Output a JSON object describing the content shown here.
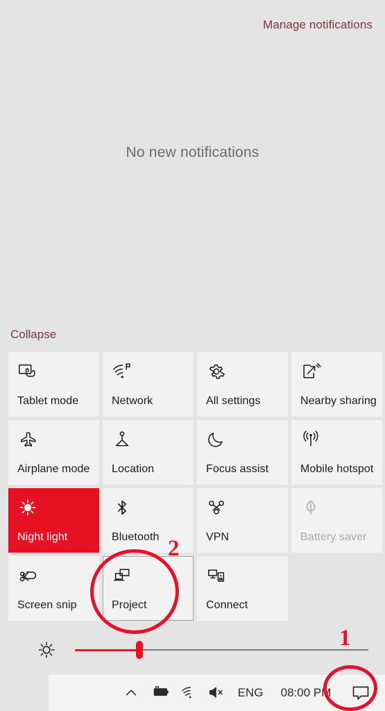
{
  "header": {
    "manage_notifications_label": "Manage notifications"
  },
  "notifications": {
    "empty_text": "No new notifications"
  },
  "collapse": {
    "label": "Collapse"
  },
  "quick_actions": {
    "tiles": [
      {
        "label": "Tablet mode",
        "icon": "tablet-mode-icon",
        "state": "normal"
      },
      {
        "label": "Network",
        "icon": "network-wifi-icon",
        "state": "normal"
      },
      {
        "label": "All settings",
        "icon": "gear-icon",
        "state": "normal"
      },
      {
        "label": "Nearby sharing",
        "icon": "nearby-sharing-icon",
        "state": "normal"
      },
      {
        "label": "Airplane mode",
        "icon": "airplane-icon",
        "state": "normal"
      },
      {
        "label": "Location",
        "icon": "location-icon",
        "state": "normal"
      },
      {
        "label": "Focus assist",
        "icon": "moon-icon",
        "state": "normal"
      },
      {
        "label": "Mobile hotspot",
        "icon": "hotspot-icon",
        "state": "normal"
      },
      {
        "label": "Night light",
        "icon": "sun-icon",
        "state": "active"
      },
      {
        "label": "Bluetooth",
        "icon": "bluetooth-icon",
        "state": "normal"
      },
      {
        "label": "VPN",
        "icon": "vpn-icon",
        "state": "normal"
      },
      {
        "label": "Battery saver",
        "icon": "leaf-icon",
        "state": "disabled"
      },
      {
        "label": "Screen snip",
        "icon": "screen-snip-icon",
        "state": "normal"
      },
      {
        "label": "Project",
        "icon": "project-icon",
        "state": "focused"
      },
      {
        "label": "Connect",
        "icon": "connect-icon",
        "state": "normal"
      },
      {
        "label": "",
        "icon": "",
        "state": "empty"
      }
    ]
  },
  "brightness": {
    "icon": "brightness-sun-icon",
    "value_percent": 22
  },
  "taskbar": {
    "chevron_icon": "chevron-up-icon",
    "battery_icon": "battery-charging-icon",
    "wifi_icon": "wifi-icon",
    "volume_icon": "volume-muted-icon",
    "language": "ENG",
    "clock": "08:00 PM",
    "action_center_icon": "action-center-speech-bubble-icon"
  },
  "annotations": {
    "marker_1": "1",
    "marker_2": "2",
    "accent_color": "#e8112a"
  },
  "colors": {
    "panel_background": "#e4e4e4",
    "tile_background": "#f2f2f2",
    "accent_red": "#e81123",
    "link_color": "#7b3640",
    "taskbar_background": "#f3f3f3"
  }
}
